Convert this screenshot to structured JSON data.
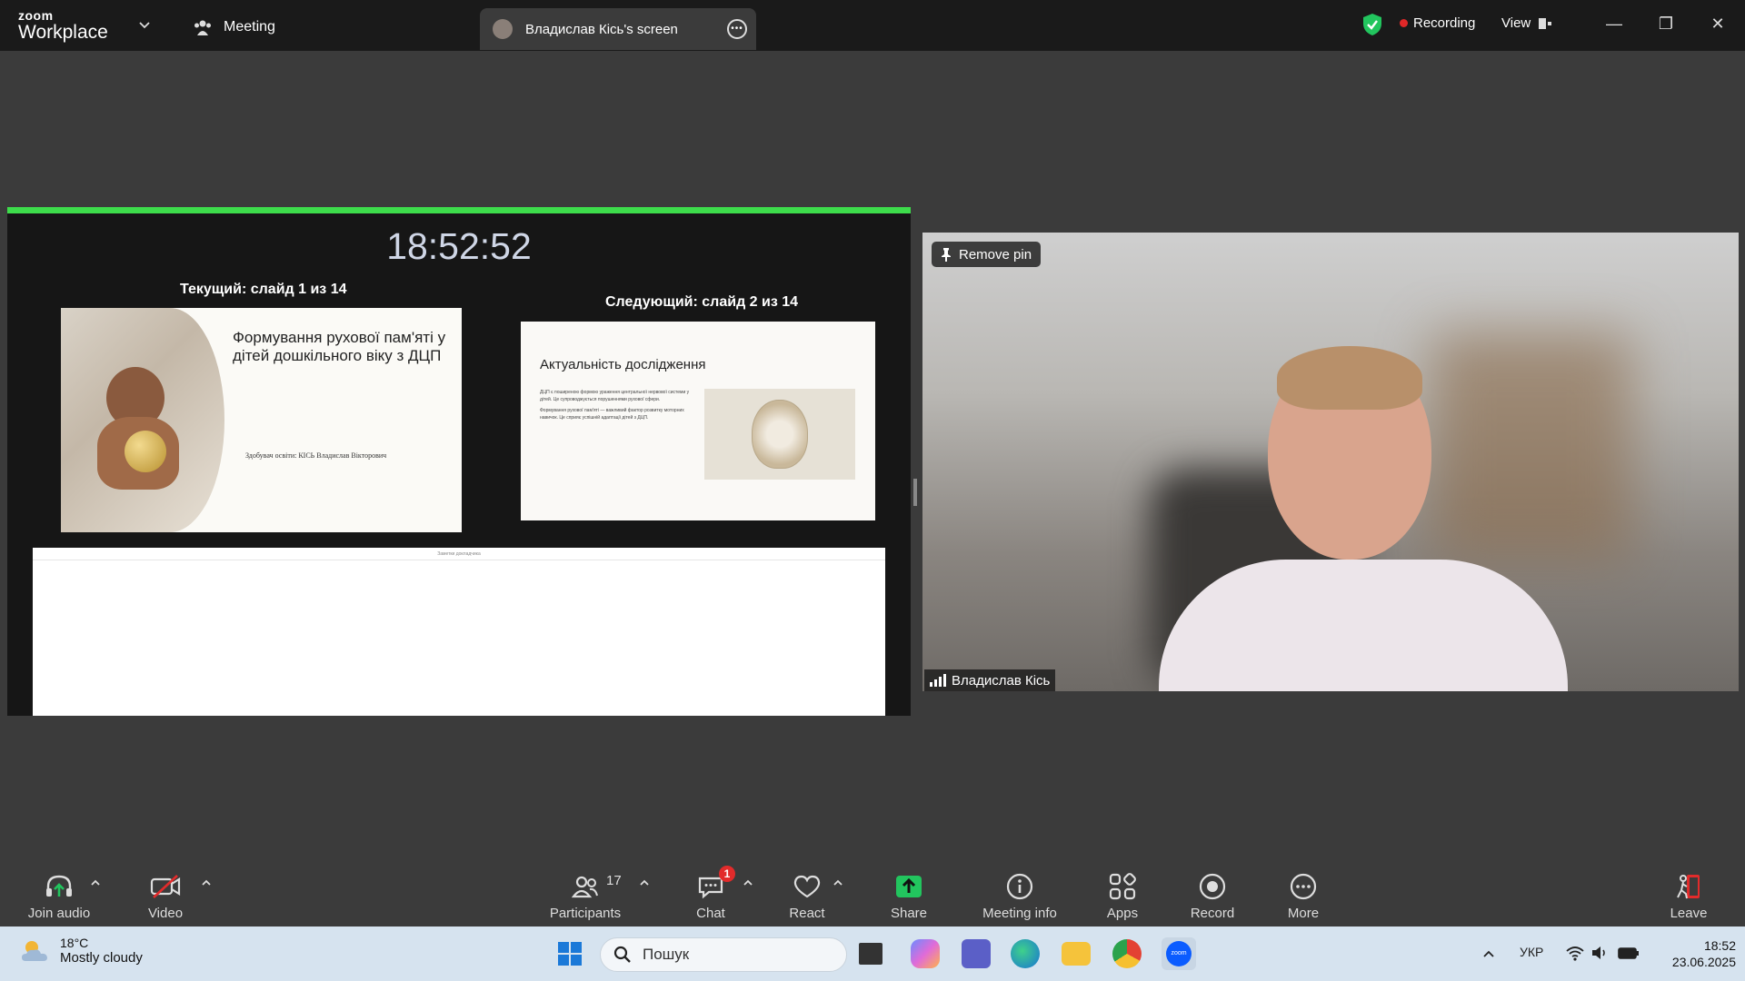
{
  "app": {
    "brand_small": "zoom",
    "brand_name": "Workplace",
    "meeting_tab": "Meeting",
    "screen_tab": "Владислав Кісь's screen",
    "recording": "Recording",
    "view": "View"
  },
  "share": {
    "clock": "18:52:52",
    "current_label": "Текущий: слайд 1 из 14",
    "next_label": "Следующий: слайд 2 из 14",
    "current_slide_title": "Формування рухової пам'яті у дітей дошкільного віку з ДЦП",
    "current_slide_author": "Здобувач освіти: КІСЬ Владислав Вікторович",
    "next_slide_title": "Актуальність дослідження",
    "next_slide_text_1": "ДЦП є поширеною формою ураження центральної нервової системи у дітей. Це супроводжується порушеннями рухової сфери.",
    "next_slide_text_2": "Формування рухової пам'яті — важливий фактор розвитку моторних навичок. Це сприяє успішній адаптації дітей з ДЦП.",
    "notes_label": "Заметки докладчика"
  },
  "video": {
    "remove_pin": "Remove pin",
    "participant_name": "Владислав Кісь"
  },
  "toolbar": {
    "join_audio": "Join audio",
    "video": "Video",
    "participants": "Participants",
    "participants_count": "17",
    "chat": "Chat",
    "chat_badge": "1",
    "react": "React",
    "share": "Share",
    "meeting_info": "Meeting info",
    "apps": "Apps",
    "record": "Record",
    "more": "More",
    "leave": "Leave"
  },
  "taskbar": {
    "temp": "18°C",
    "condition": "Mostly cloudy",
    "search_placeholder": "Пошук",
    "language": "УКР",
    "time": "18:52",
    "date": "23.06.2025"
  },
  "colors": {
    "share_bar": "#3ddc4b",
    "leave": "#e22b2b",
    "share_button": "#22c55e",
    "recording_dot": "#e02828"
  }
}
